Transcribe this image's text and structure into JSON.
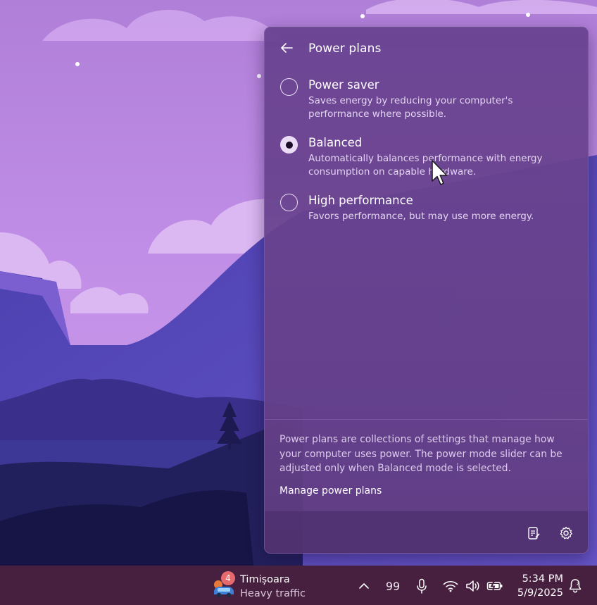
{
  "flyout": {
    "title": "Power plans",
    "plans": [
      {
        "name": "Power saver",
        "description": "Saves energy by reducing your computer's performance where possible.",
        "selected": false
      },
      {
        "name": "Balanced",
        "description": "Automatically balances performance with energy consumption on capable hardware.",
        "selected": true
      },
      {
        "name": "High performance",
        "description": "Favors performance, but may use more energy.",
        "selected": false
      }
    ],
    "info": "Power plans are collections of settings that manage how your computer uses power. The power mode slider can be adjusted only when Balanced mode is selected.",
    "manage_link": "Manage power plans",
    "footer_icons": [
      "edit-quick-settings-icon",
      "settings-gear-icon"
    ]
  },
  "taskbar": {
    "weather": {
      "badge": "4",
      "city": "Timișoara",
      "status": "Heavy traffic",
      "icon": "car-traffic-icon"
    },
    "tray": {
      "chevron_icon": "chevron-up-icon",
      "count": "99",
      "icons": [
        "microphone-icon",
        "wifi-icon",
        "speaker-icon",
        "battery-charging-icon"
      ]
    },
    "clock": {
      "time": "5:34 PM",
      "date": "5/9/2025"
    },
    "notification_icon": "notification-bell-icon"
  },
  "colors": {
    "panel": "#684292",
    "taskbar": "#47203f",
    "wallpaper_sky": "#c08ee6",
    "wallpaper_mountain": "#5a4ab8"
  }
}
